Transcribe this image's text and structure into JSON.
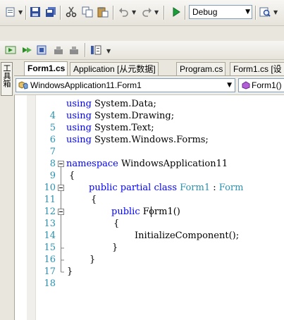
{
  "toolbar_top": {
    "buttons": [
      {
        "name": "new-item-icon"
      },
      {
        "name": "save-icon"
      },
      {
        "name": "save-all-icon"
      },
      {
        "name": "cut-icon"
      },
      {
        "name": "copy-icon"
      },
      {
        "name": "paste-icon"
      },
      {
        "name": "undo-icon"
      },
      {
        "name": "redo-icon"
      },
      {
        "name": "start-debug-icon"
      },
      {
        "name": "find-in-files-icon"
      }
    ],
    "configuration": "Debug"
  },
  "toolbar_debug": {
    "buttons": [
      {
        "name": "step-into-icon"
      },
      {
        "name": "step-over-icon"
      },
      {
        "name": "step-out-icon"
      },
      {
        "name": "breakpoint-icon"
      },
      {
        "name": "clear-breakpoints-icon"
      },
      {
        "name": "properties-icon"
      }
    ]
  },
  "toolbox": {
    "label": "工具箱"
  },
  "tabs": [
    {
      "label": "Form1.cs",
      "active": true
    },
    {
      "label": "Application [从元数据]",
      "active": false
    },
    {
      "label": "Program.cs",
      "active": false
    },
    {
      "label": "Form1.cs [设",
      "active": false
    }
  ],
  "navbar": {
    "type_combo": "WindowsApplication11.Form1",
    "member_combo": "Form1()"
  },
  "code": {
    "lines": [
      {
        "num": "4",
        "text": "using System.Data;"
      },
      {
        "num": "5",
        "text": "using System.Drawing;"
      },
      {
        "num": "6",
        "text": "using System.Text;"
      },
      {
        "num": "7",
        "text": "using System.Windows.Forms;"
      },
      {
        "num": "8",
        "text": ""
      },
      {
        "num": "9",
        "text": "namespace WindowsApplication11"
      },
      {
        "num": "10",
        "text": "{"
      },
      {
        "num": "11",
        "text": "public partial class Form1 : Form"
      },
      {
        "num": "12",
        "text": "{"
      },
      {
        "num": "13",
        "text": "public Form1()"
      },
      {
        "num": "14",
        "text": "{"
      },
      {
        "num": "15",
        "text": "InitializeComponent();"
      },
      {
        "num": "16",
        "text": "}"
      },
      {
        "num": "17",
        "text": "}"
      },
      {
        "num": "18",
        "text": "}"
      }
    ],
    "tokens": {
      "using": "using",
      "ns_data": "System.Data;",
      "ns_drawing": "System.Drawing;",
      "ns_text": "System.Text;",
      "ns_forms": "System.Windows.Forms;",
      "namespace": "namespace",
      "ns_name": "WindowsApplication11",
      "public": "public",
      "partial": "partial",
      "class": "class",
      "form1": "Form1",
      "colon": ":",
      "form": "Form",
      "ctor": "Form1()",
      "init": "InitializeComponent();",
      "open_brace": "{",
      "close_brace": "}"
    }
  },
  "colors": {
    "keyword": "#0000ff",
    "type": "#2b91af",
    "line_number": "#2b91af"
  }
}
